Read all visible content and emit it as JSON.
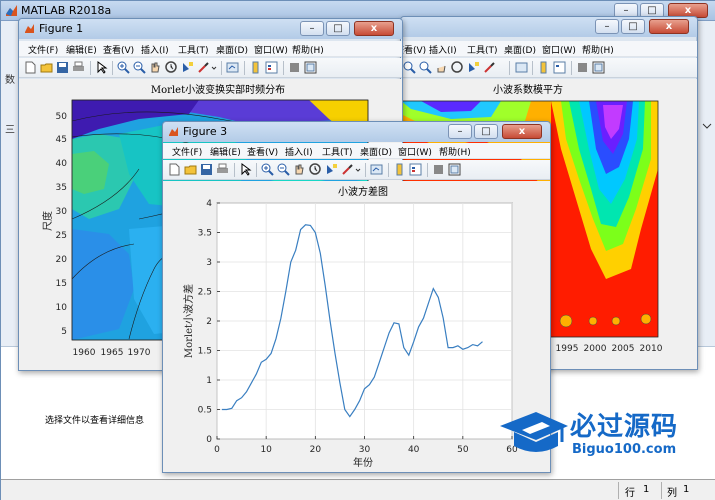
{
  "main": {
    "title": "MATLAB R2018a",
    "left_strip_labels": [
      "数",
      "三",
      "详"
    ],
    "hint": "选择文件以查看详细信息",
    "status": {
      "row_label": "行",
      "row_value": "1",
      "col_label": "列",
      "col_value": "1"
    }
  },
  "menus": [
    "文件(F)",
    "编辑(E)",
    "查看(V)",
    "插入(I)",
    "工具(T)",
    "桌面(D)",
    "窗口(W)",
    "帮助(H)"
  ],
  "caption_buttons": {
    "minimize": "–",
    "maximize": "□",
    "close": "x"
  },
  "figure1": {
    "title": "Figure 1",
    "plot_title": "Morlet小波变换实部时频分布",
    "ylabel": "尺度",
    "yticks": [
      "5",
      "10",
      "15",
      "20",
      "25",
      "30",
      "35",
      "40",
      "45",
      "50"
    ],
    "xticks": [
      "1960",
      "1965",
      "1970"
    ]
  },
  "figure2": {
    "plot_title": "小波系数模平方",
    "xticks": [
      "1995",
      "2000",
      "2005",
      "2010"
    ]
  },
  "figure3": {
    "title": "Figure 3",
    "plot_title": "小波方差图",
    "xlabel": "年份",
    "ylabel": "Morlet小波方差"
  },
  "chart_data": {
    "type": "line",
    "title": "小波方差图",
    "xlabel": "年份",
    "ylabel": "Morlet小波方差",
    "xlim": [
      0,
      60
    ],
    "ylim": [
      0,
      4
    ],
    "xticks": [
      0,
      10,
      20,
      30,
      40,
      50,
      60
    ],
    "yticks": [
      0,
      0.5,
      1,
      1.5,
      2,
      2.5,
      3,
      3.5,
      4
    ],
    "grid": true,
    "line_color": "#3a7fc1",
    "x": [
      1,
      2,
      3,
      4,
      5,
      6,
      7,
      8,
      9,
      10,
      11,
      12,
      13,
      14,
      15,
      16,
      17,
      18,
      19,
      20,
      21,
      22,
      23,
      24,
      25,
      26,
      27,
      28,
      29,
      30,
      31,
      32,
      33,
      34,
      35,
      36,
      37,
      38,
      39,
      40,
      41,
      42,
      43,
      44,
      45,
      46,
      47,
      48,
      49,
      50,
      51,
      52,
      53,
      54
    ],
    "y": [
      0.5,
      0.5,
      0.52,
      0.65,
      0.7,
      0.8,
      0.95,
      1.1,
      1.3,
      1.35,
      1.45,
      1.7,
      2.05,
      2.5,
      3.0,
      3.2,
      3.55,
      3.63,
      3.62,
      3.5,
      3.15,
      2.6,
      2.0,
      1.45,
      0.95,
      0.5,
      0.38,
      0.5,
      0.65,
      0.85,
      0.92,
      1.05,
      1.3,
      1.55,
      1.8,
      1.97,
      1.95,
      1.55,
      1.42,
      1.65,
      1.9,
      2.05,
      2.3,
      2.55,
      2.4,
      2.05,
      1.55,
      1.55,
      1.58,
      1.52,
      1.55,
      1.6,
      1.58,
      1.65
    ]
  },
  "watermark": {
    "brand_cn": "必过源码",
    "brand_en": "Biguo100.com"
  },
  "colors": {
    "plot_line": "#3a7fc1",
    "window_title": "#b3cbe7",
    "close_button": "#c74b36",
    "watermark": "#1569c7"
  }
}
